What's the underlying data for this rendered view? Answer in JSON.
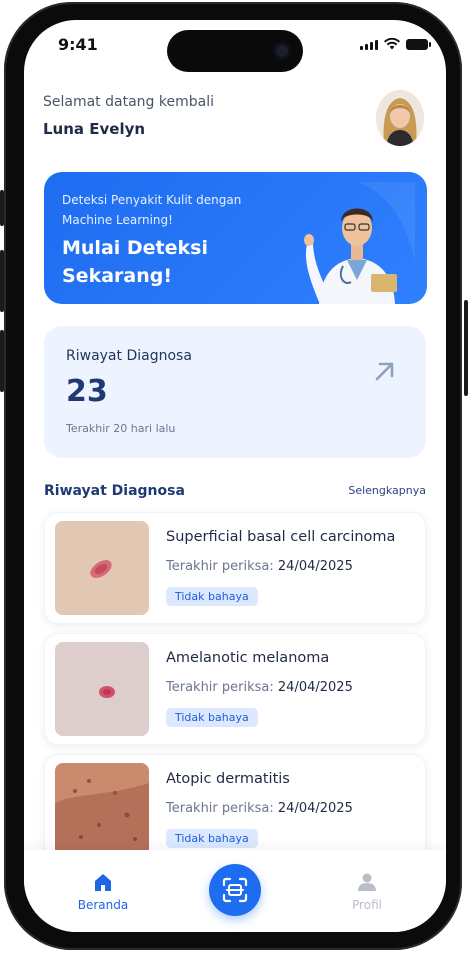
{
  "status_bar": {
    "time": "9:41"
  },
  "header": {
    "greeting": "Selamat datang kembali",
    "user_name": "Luna Evelyn"
  },
  "banner": {
    "subtitle": "Deteksi Penyakit Kulit dengan Machine Learning!",
    "title": "Mulai Deteksi Sekarang!"
  },
  "stats": {
    "label": "Riwayat Diagnosa",
    "count": "23",
    "last": "Terakhir 20 hari lalu"
  },
  "history": {
    "title": "Riwayat Diagnosa",
    "see_more": "Selengkapnya",
    "items": [
      {
        "diagnosis": "Superficial basal cell carcinoma",
        "checked_label": "Terakhir periksa:",
        "date": "24/04/2025",
        "badge": "Tidak bahaya"
      },
      {
        "diagnosis": "Amelanotic melanoma",
        "checked_label": "Terakhir periksa:",
        "date": "24/04/2025",
        "badge": "Tidak bahaya"
      },
      {
        "diagnosis": "Atopic dermatitis",
        "checked_label": "Terakhir periksa:",
        "date": "24/04/2025",
        "badge": "Tidak bahaya"
      }
    ]
  },
  "tabbar": {
    "home": "Beranda",
    "profile": "Profil",
    "scan_icon": "scan-face-icon"
  },
  "colors": {
    "primary": "#1e6cf0",
    "card_bg": "#eef4ff",
    "badge_bg": "#dbe8ff"
  }
}
